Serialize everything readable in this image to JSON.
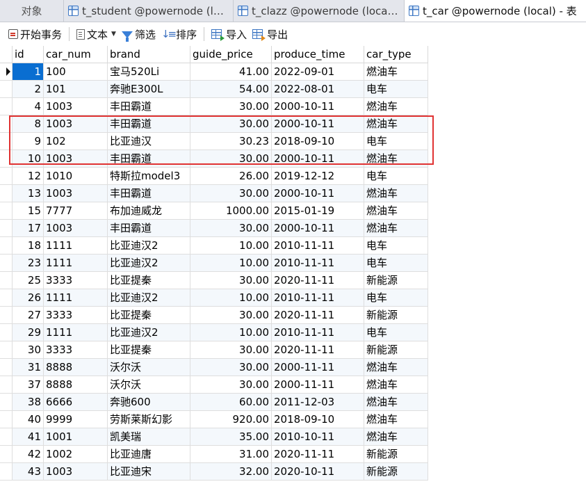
{
  "tabs": [
    {
      "label": "对象"
    },
    {
      "label": "t_student @powernode (loc..."
    },
    {
      "label": "t_clazz @powernode (local) ..."
    },
    {
      "label": "t_car @powernode (local) - 表"
    }
  ],
  "toolbar": {
    "begin_transaction": "开始事务",
    "text": "文本",
    "filter": "筛选",
    "sort": "排序",
    "import": "导入",
    "export": "导出"
  },
  "grid": {
    "columns": [
      "id",
      "car_num",
      "brand",
      "guide_price",
      "produce_time",
      "car_type"
    ],
    "rows": [
      [
        "1",
        "100",
        "宝马520Li",
        "41.00",
        "2022-09-01",
        "燃油车"
      ],
      [
        "2",
        "101",
        "奔驰E300L",
        "54.00",
        "2022-08-01",
        "电车"
      ],
      [
        "4",
        "1003",
        "丰田霸道",
        "30.00",
        "2000-10-11",
        "燃油车"
      ],
      [
        "8",
        "1003",
        "丰田霸道",
        "30.00",
        "2000-10-11",
        "燃油车"
      ],
      [
        "9",
        "102",
        "比亚迪汉",
        "30.23",
        "2018-09-10",
        "电车"
      ],
      [
        "10",
        "1003",
        "丰田霸道",
        "30.00",
        "2000-10-11",
        "燃油车"
      ],
      [
        "12",
        "1010",
        "特斯拉model3",
        "26.00",
        "2019-12-12",
        "电车"
      ],
      [
        "13",
        "1003",
        "丰田霸道",
        "30.00",
        "2000-10-11",
        "燃油车"
      ],
      [
        "15",
        "7777",
        "布加迪威龙",
        "1000.00",
        "2015-01-19",
        "燃油车"
      ],
      [
        "17",
        "1003",
        "丰田霸道",
        "30.00",
        "2000-10-11",
        "燃油车"
      ],
      [
        "18",
        "1111",
        "比亚迪汉2",
        "10.00",
        "2010-11-11",
        "电车"
      ],
      [
        "23",
        "1111",
        "比亚迪汉2",
        "10.00",
        "2010-11-11",
        "电车"
      ],
      [
        "25",
        "3333",
        "比亚提秦",
        "30.00",
        "2020-11-11",
        "新能源"
      ],
      [
        "26",
        "1111",
        "比亚迪汉2",
        "10.00",
        "2010-11-11",
        "电车"
      ],
      [
        "27",
        "3333",
        "比亚提秦",
        "30.00",
        "2020-11-11",
        "新能源"
      ],
      [
        "29",
        "1111",
        "比亚迪汉2",
        "10.00",
        "2010-11-11",
        "电车"
      ],
      [
        "30",
        "3333",
        "比亚提秦",
        "30.00",
        "2020-11-11",
        "新能源"
      ],
      [
        "31",
        "8888",
        "沃尔沃",
        "30.00",
        "2000-11-11",
        "燃油车"
      ],
      [
        "37",
        "8888",
        "沃尔沃",
        "30.00",
        "2000-11-11",
        "燃油车"
      ],
      [
        "38",
        "6666",
        "奔驰600",
        "60.00",
        "2011-12-03",
        "燃油车"
      ],
      [
        "40",
        "9999",
        "劳斯莱斯幻影",
        "920.00",
        "2018-09-10",
        "燃油车"
      ],
      [
        "41",
        "1001",
        "凯美瑞",
        "35.00",
        "2010-10-11",
        "燃油车"
      ],
      [
        "42",
        "1002",
        "比亚迪唐",
        "31.00",
        "2020-11-11",
        "新能源"
      ],
      [
        "43",
        "1003",
        "比亚迪宋",
        "32.00",
        "2020-10-11",
        "新能源"
      ]
    ]
  },
  "colors": {
    "selection": "#0a6ed1",
    "highlight_box": "#e03232",
    "alt_row": "#f4f8fc"
  }
}
